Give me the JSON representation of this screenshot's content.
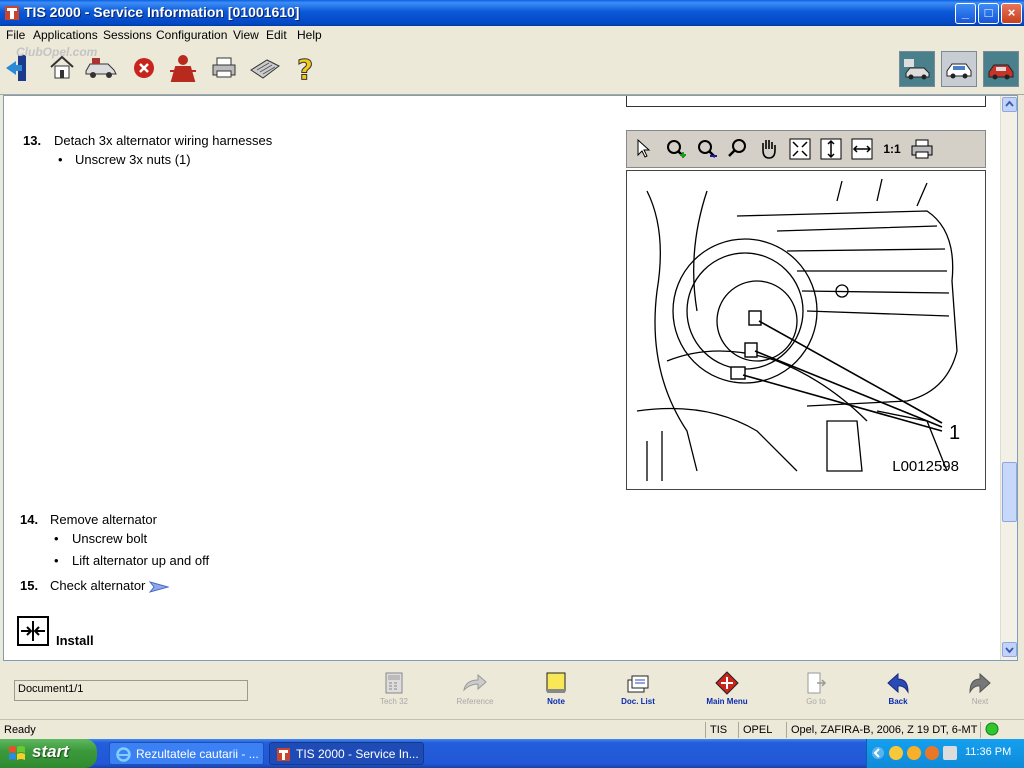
{
  "window": {
    "title": "TIS 2000 - Service Information [01001610]",
    "watermark": "ClubOpel.com",
    "controls": {
      "minimize": "_",
      "maximize": "□",
      "close": "×"
    }
  },
  "menu": [
    "File",
    "Applications",
    "Sessions",
    "Configuration",
    "View",
    "Edit",
    "Help"
  ],
  "toolbar": {
    "icons": [
      "exit-icon",
      "home-icon",
      "vehicle-select-icon",
      "stop-icon",
      "user-icon",
      "print-icon",
      "keyboard-icon",
      "help-icon"
    ],
    "right_icons": [
      "tech32-car-icon",
      "diagnostics-car-icon",
      "service-car-icon"
    ]
  },
  "steps": [
    {
      "num": "13.",
      "text": "Detach 3x alternator wiring harnesses",
      "bullets": [
        "Unscrew 3x nuts (1)"
      ]
    },
    {
      "num": "14.",
      "text": "Remove alternator",
      "bullets": [
        "Unscrew bolt",
        "Lift alternator up and off"
      ]
    },
    {
      "num": "15.",
      "text": "Check alternator",
      "bullets": []
    }
  ],
  "image_tools": {
    "one_to_one": "1:1"
  },
  "figure": {
    "callout": "1",
    "reference": "L0012598"
  },
  "section": {
    "label": "Install"
  },
  "bottom_bar": {
    "document_field": "Document1/1",
    "buttons": [
      {
        "label": "Tech 32",
        "enabled": false
      },
      {
        "label": "Reference",
        "enabled": false
      },
      {
        "label": "Note",
        "enabled": true
      },
      {
        "label": "Doc. List",
        "enabled": true
      },
      {
        "label": "Main Menu",
        "enabled": true
      },
      {
        "label": "Go to",
        "enabled": false
      },
      {
        "label": "Back",
        "enabled": true
      },
      {
        "label": "Next",
        "enabled": false
      }
    ]
  },
  "status": {
    "text": "Ready",
    "app": "TIS",
    "make": "OPEL",
    "vehicle": "Opel, ZAFIRA-B, 2006, Z 19 DT, 6-MT"
  },
  "taskbar": {
    "start": "start",
    "tasks": [
      "Rezultatele cautarii - ...",
      "TIS 2000 - Service In..."
    ],
    "clock": "11:36 PM"
  },
  "colors": {
    "title_bar": "#0a5fe4",
    "link_blue": "#0a2bb0",
    "disabled_gray": "#a8a8a8",
    "taskbar_blue": "#245edb",
    "start_green": "#3c9a3c"
  }
}
